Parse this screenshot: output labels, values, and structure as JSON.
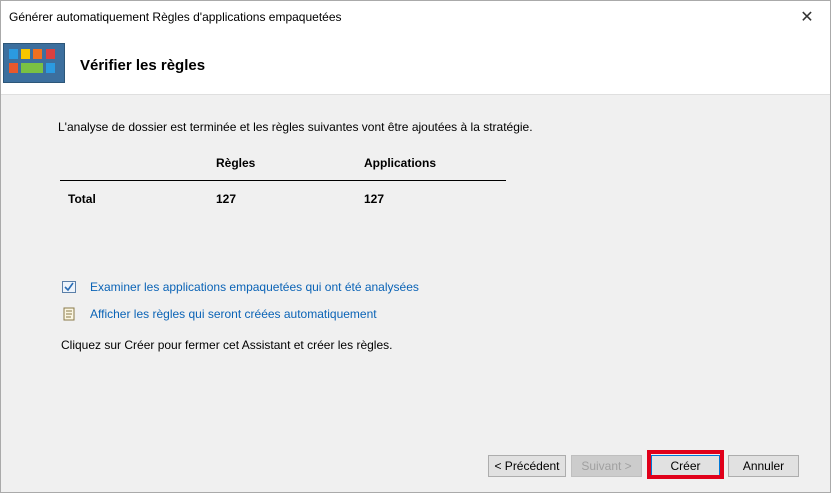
{
  "window": {
    "title": "Générer automatiquement Règles d'applications empaquetées",
    "close_glyph": "✕"
  },
  "header": {
    "title": "Vérifier les règles",
    "icon": "packaged-apps-icon"
  },
  "main": {
    "intro": "L'analyse de dossier est terminée et les règles suivantes vont être ajoutées à la stratégie.",
    "table": {
      "columns": [
        "",
        "Règles",
        "Applications"
      ],
      "rows": [
        {
          "label": "Total",
          "rules": "127",
          "applications": "127"
        }
      ]
    },
    "links": [
      {
        "label": "Examiner les applications empaquetées qui ont été analysées",
        "icon": "checklist-icon"
      },
      {
        "label": "Afficher les règles qui seront créées automatiquement",
        "icon": "scroll-icon"
      }
    ],
    "outro": "Cliquez sur Créer pour fermer cet Assistant et créer les règles."
  },
  "footer": {
    "previous_label": "< Précédent",
    "next_label": "Suivant >",
    "create_label": "Créer",
    "cancel_label": "Annuler"
  },
  "colors": {
    "link": "#0a63b6",
    "highlight": "#e0001a",
    "window_bg": "#f0f0f0"
  }
}
